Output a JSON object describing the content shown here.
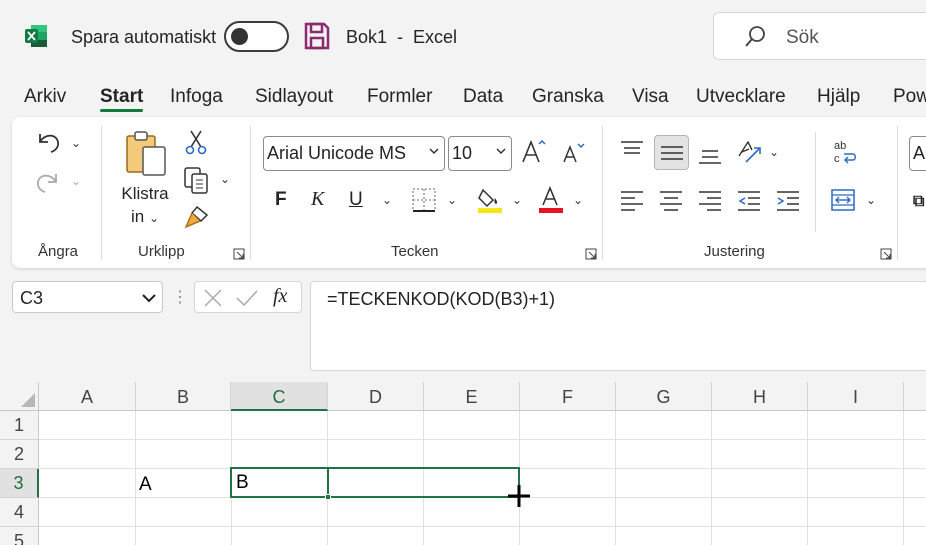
{
  "titlebar": {
    "app_icon": "excel-logo-icon",
    "autosave_label": "Spara automatiskt",
    "autosave_state": "off",
    "save_icon": "save-icon",
    "file_title": "Bok1  -  Excel",
    "search_placeholder": "Sök"
  },
  "tabs": [
    "Arkiv",
    "Start",
    "Infoga",
    "Sidlayout",
    "Formler",
    "Data",
    "Granska",
    "Visa",
    "Utvecklare",
    "Hjälp",
    "Pow"
  ],
  "active_tab": "Start",
  "ribbon": {
    "undo_group": {
      "label": "Ångra",
      "icons": [
        "undo-icon",
        "redo-icon"
      ]
    },
    "clipboard_group": {
      "label": "Urklipp",
      "paste_label_1": "Klistra",
      "paste_label_2": "in",
      "icons": [
        "paste-icon",
        "cut-icon",
        "copy-icon",
        "format-painter-icon"
      ]
    },
    "font_group": {
      "label": "Tecken",
      "font_name": "Arial Unicode MS",
      "font_size": "10",
      "bold": "F",
      "italic": "K",
      "underline": "U",
      "icons": [
        "increase-font-icon",
        "decrease-font-icon",
        "borders-icon",
        "fill-color-icon",
        "font-color-icon"
      ],
      "fill_color": "#f5e619",
      "font_color": "#e81123"
    },
    "alignment_group": {
      "label": "Justering",
      "icons": [
        "align-top-icon",
        "align-middle-icon",
        "align-bottom-icon",
        "orientation-icon",
        "align-left-icon",
        "align-center-icon",
        "align-right-icon",
        "decrease-indent-icon",
        "increase-indent-icon",
        "wrap-text-icon",
        "merge-center-icon"
      ]
    },
    "next_group_partial": "Al"
  },
  "formula_bar": {
    "name_box": "C3",
    "fx_label": "fx",
    "formula": "=TECKENKOD(KOD(B3)+1)"
  },
  "sheet": {
    "columns": [
      "A",
      "B",
      "C",
      "D",
      "E",
      "F",
      "G",
      "H",
      "I"
    ],
    "rows": [
      "1",
      "2",
      "3",
      "4",
      "5"
    ],
    "selected_column": "C",
    "selected_row": "3",
    "cells": {
      "B3": "A",
      "C3": "B"
    },
    "accent_color": "#217346"
  }
}
